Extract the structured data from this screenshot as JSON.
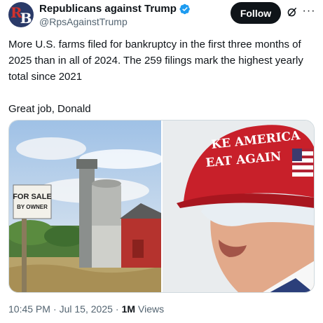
{
  "account": {
    "display_name": "Republicans against Trump",
    "handle": "@RpsAgainstTrump",
    "avatar_letters": "RB",
    "verified": true
  },
  "actions": {
    "follow_label": "Follow",
    "grok_icon": "grok-icon",
    "more_icon": "more-icon"
  },
  "tweet": {
    "text": "More U.S. farms filed for bankruptcy in the first three months of 2025 than in all of 2024. The 259 filings mark the highest yearly total since 2021\n\nGreat job, Donald"
  },
  "media": {
    "left_sign_line1": "FOR SALE",
    "left_sign_line2": "BY OWNER",
    "right_hat_line1": "KE AMERICA",
    "right_hat_line2": "EAT AGAIN"
  },
  "meta": {
    "time": "10:45 PM",
    "separator": "·",
    "date": "Jul 15, 2025",
    "views_count": "1M",
    "views_label": "Views"
  },
  "colors": {
    "verified_blue": "#1d9bf0",
    "text_primary": "#0f1419",
    "text_secondary": "#536471",
    "hat_red": "#c8202a"
  }
}
